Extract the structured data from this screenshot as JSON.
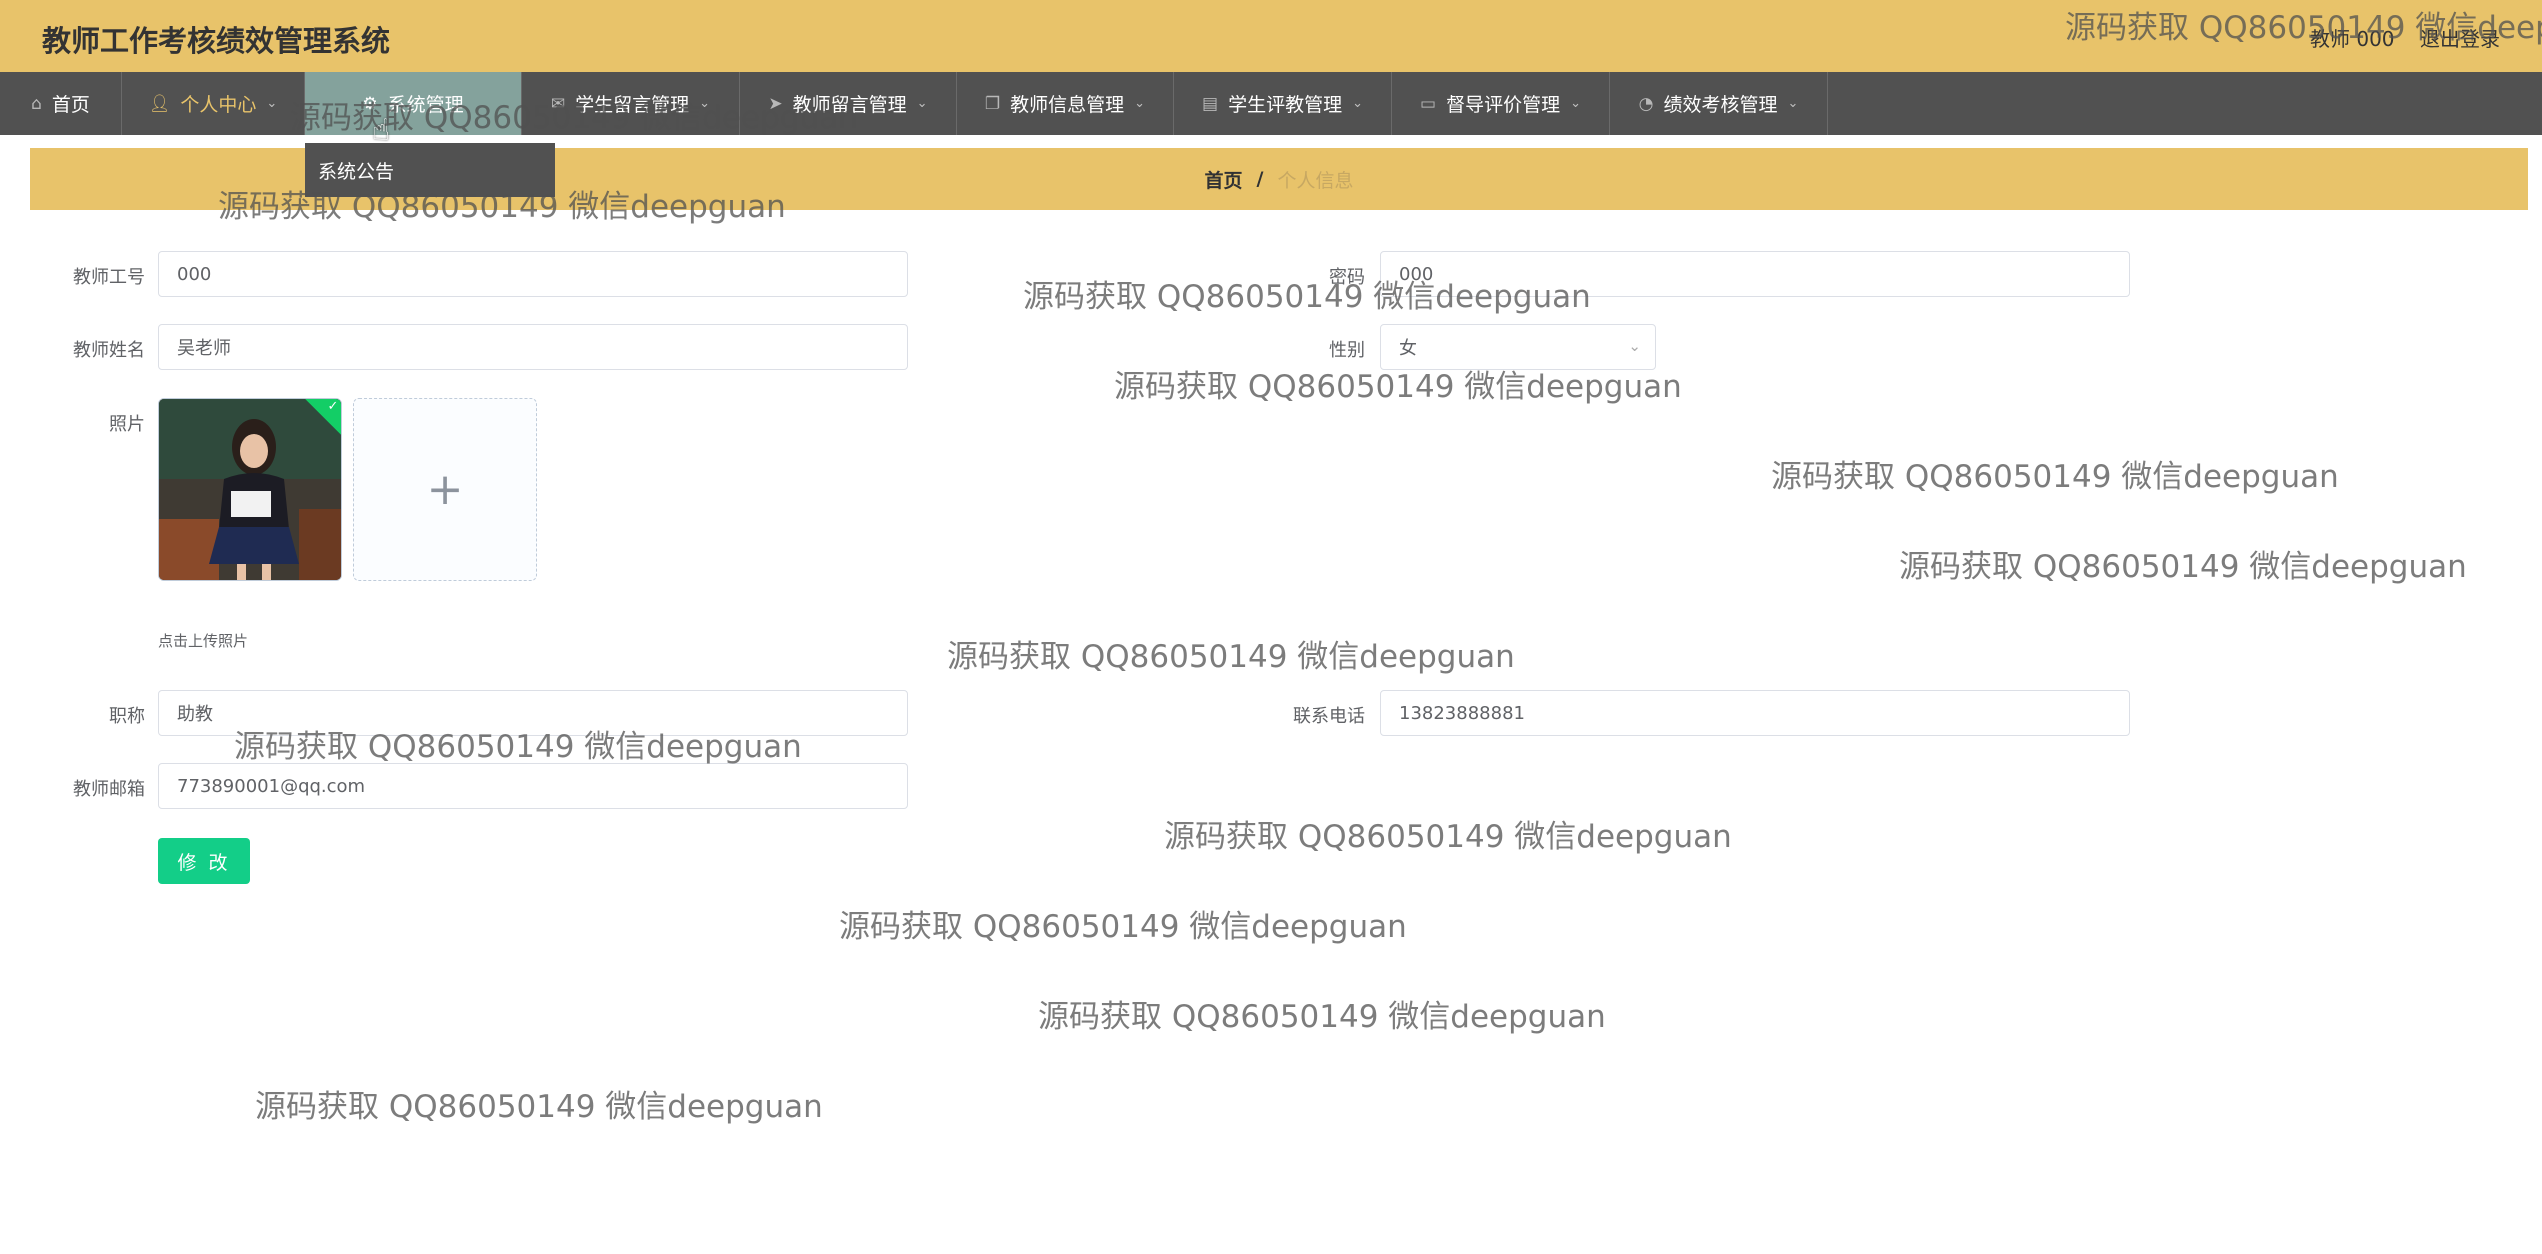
{
  "header": {
    "title": "教师工作考核绩效管理系统",
    "user": "教师 000",
    "logout": "退出登录"
  },
  "nav": {
    "items": [
      {
        "label": "首页",
        "icon": "home-icon"
      },
      {
        "label": "个人中心",
        "icon": "user-icon"
      },
      {
        "label": "系统管理",
        "icon": "gear-icon"
      },
      {
        "label": "学生留言管理",
        "icon": "message-icon"
      },
      {
        "label": "教师留言管理",
        "icon": "send-icon"
      },
      {
        "label": "教师信息管理",
        "icon": "copy-icon"
      },
      {
        "label": "学生评教管理",
        "icon": "clipboard-icon"
      },
      {
        "label": "督导评价管理",
        "icon": "monitor-icon"
      },
      {
        "label": "绩效考核管理",
        "icon": "gauge-icon"
      }
    ],
    "dropdown_item": "系统公告"
  },
  "breadcrumb": {
    "home": "首页",
    "separator": "/",
    "current": "个人信息"
  },
  "form": {
    "teacher_id": {
      "label": "教师工号",
      "value": "000"
    },
    "password": {
      "label": "密码",
      "value": "000"
    },
    "teacher_name": {
      "label": "教师姓名",
      "value": "吴老师"
    },
    "gender": {
      "label": "性别",
      "value": "女"
    },
    "photo": {
      "label": "照片",
      "upload_tip": "点击上传照片"
    },
    "title": {
      "label": "职称",
      "value": "助教"
    },
    "phone": {
      "label": "联系电话",
      "value": "13823888881"
    },
    "email": {
      "label": "教师邮箱",
      "value": "773890001@qq.com"
    },
    "submit": "修 改"
  },
  "watermark": "源码获取 QQ86050149 微信deepguan",
  "colors": {
    "header_bg": "#e8c36a",
    "nav_bg": "#515151",
    "accent": "#13ce88"
  }
}
